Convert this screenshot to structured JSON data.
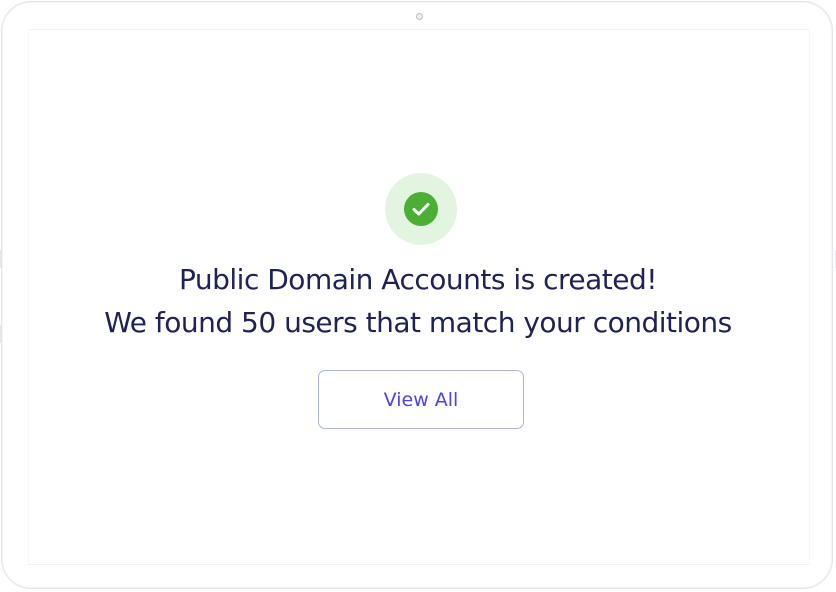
{
  "dialog": {
    "title_line1": "Public Domain Accounts is created!",
    "title_line2": "We found 50 users that match your conditions",
    "status_icon": "check-circle-icon",
    "success_color": "#4caf35",
    "success_bg": "#e3f4e1",
    "text_color": "#1f2256"
  },
  "actions": {
    "view_all_label": "View All",
    "accent_color": "#4b44e8"
  }
}
